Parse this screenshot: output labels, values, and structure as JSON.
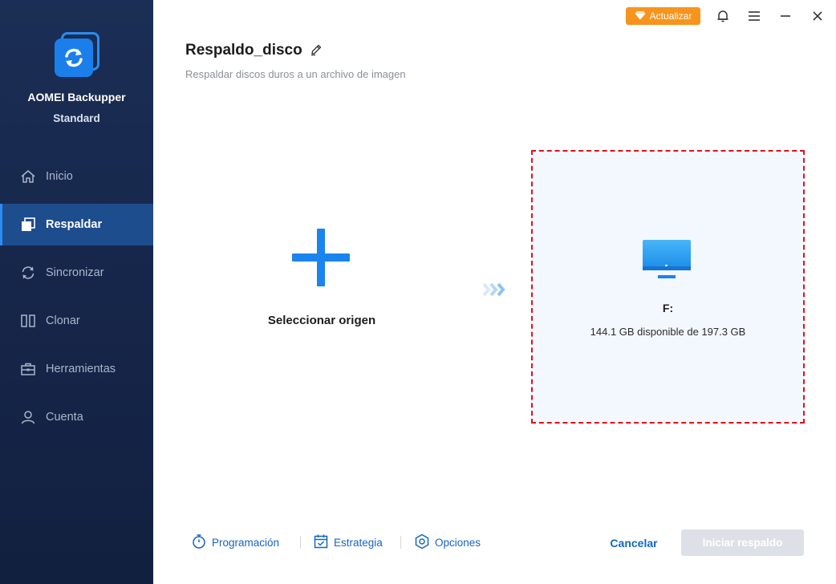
{
  "app": {
    "name": "AOMEI Backupper",
    "edition": "Standard"
  },
  "sidebar": {
    "items": [
      {
        "label": "Inicio",
        "icon": "home-icon",
        "active": false
      },
      {
        "label": "Respaldar",
        "icon": "backup-icon",
        "active": true
      },
      {
        "label": "Sincronizar",
        "icon": "sync-icon",
        "active": false
      },
      {
        "label": "Clonar",
        "icon": "clone-icon",
        "active": false
      },
      {
        "label": "Herramientas",
        "icon": "toolbox-icon",
        "active": false
      },
      {
        "label": "Cuenta",
        "icon": "user-icon",
        "active": false
      }
    ]
  },
  "topbar": {
    "upgrade_label": "Actualizar",
    "icons": [
      "bell-icon",
      "menu-icon",
      "minimize-icon",
      "close-icon"
    ]
  },
  "header": {
    "title": "Respaldo_disco",
    "subtitle": "Respaldar discos duros a un archivo de imagen"
  },
  "source": {
    "label": "Seleccionar origen"
  },
  "destination": {
    "drive": "F:",
    "free_space": "144.1 GB disponible de 197.3 GB"
  },
  "footer": {
    "schedule_label": "Programación",
    "scheme_label": "Estrategia",
    "options_label": "Opciones",
    "cancel_label": "Cancelar",
    "start_label": "Iniciar respaldo"
  },
  "colors": {
    "sidebar_bg": "#16264a",
    "sidebar_active": "#1e4d8e",
    "accent": "#1a84ef",
    "upgrade": "#f7941d",
    "dest_border": "#e3101b",
    "link": "#1565c0",
    "disabled_button": "#dde0e6"
  }
}
